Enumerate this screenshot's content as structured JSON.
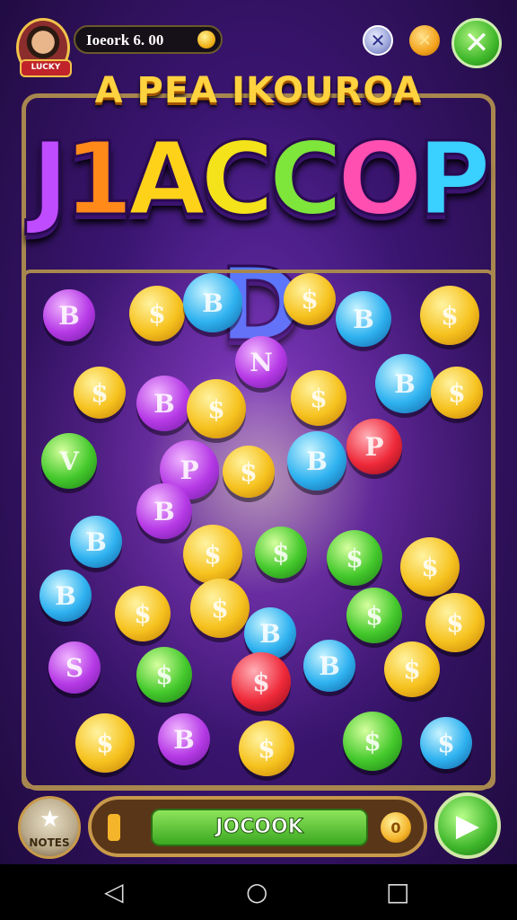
{
  "hud": {
    "avatar_tag": "LUCKY",
    "score_text": "Ioeork 6. 00",
    "btn_x1": "✕",
    "btn_x2": "✕",
    "close": "✕"
  },
  "subtitle": "A PEA IKOUROA",
  "title_letters": [
    "J",
    "1",
    "A",
    "C",
    "C",
    "O",
    "P",
    "D"
  ],
  "title_colors": [
    "#c04cff",
    "#ff8a1a",
    "#ffd21a",
    "#f4e21a",
    "#7ee63a",
    "#ff4fb0",
    "#3ad0ff",
    "#4f7bff"
  ],
  "bottom": {
    "notes_label": "NOTES",
    "action_label": "JOCOOK",
    "coin_icon": "coin-icon",
    "play_icon": "▶"
  },
  "nav": {
    "back": "◁",
    "home": "○",
    "recent": "□"
  },
  "coins": [
    {
      "c": "purple",
      "g": "B"
    },
    {
      "c": "gold",
      "g": "$"
    },
    {
      "c": "blue",
      "g": "B"
    },
    {
      "c": "gold",
      "g": "$"
    },
    {
      "c": "blue",
      "g": "B"
    },
    {
      "c": "gold",
      "g": "$"
    },
    {
      "c": "gold",
      "g": "$"
    },
    {
      "c": "purple",
      "g": "B"
    },
    {
      "c": "gold",
      "g": "$"
    },
    {
      "c": "purple",
      "g": "N"
    },
    {
      "c": "gold",
      "g": "$"
    },
    {
      "c": "blue",
      "g": "B"
    },
    {
      "c": "gold",
      "g": "$"
    },
    {
      "c": "green",
      "g": "V"
    },
    {
      "c": "purple",
      "g": "P"
    },
    {
      "c": "gold",
      "g": "$"
    },
    {
      "c": "red",
      "g": "P"
    },
    {
      "c": "blue",
      "g": "B"
    },
    {
      "c": "blue",
      "g": "B"
    },
    {
      "c": "purple",
      "g": "B"
    },
    {
      "c": "gold",
      "g": "$"
    },
    {
      "c": "green",
      "g": "$"
    },
    {
      "c": "green",
      "g": "$"
    },
    {
      "c": "gold",
      "g": "$"
    },
    {
      "c": "blue",
      "g": "B"
    },
    {
      "c": "gold",
      "g": "$"
    },
    {
      "c": "gold",
      "g": "$"
    },
    {
      "c": "blue",
      "g": "B"
    },
    {
      "c": "green",
      "g": "$"
    },
    {
      "c": "gold",
      "g": "$"
    },
    {
      "c": "purple",
      "g": "S"
    },
    {
      "c": "green",
      "g": "$"
    },
    {
      "c": "red",
      "g": "$"
    },
    {
      "c": "blue",
      "g": "B"
    },
    {
      "c": "gold",
      "g": "$"
    },
    {
      "c": "gold",
      "g": "$"
    },
    {
      "c": "purple",
      "g": "B"
    },
    {
      "c": "gold",
      "g": "$"
    },
    {
      "c": "green",
      "g": "$"
    },
    {
      "c": "blue",
      "g": "$"
    }
  ]
}
